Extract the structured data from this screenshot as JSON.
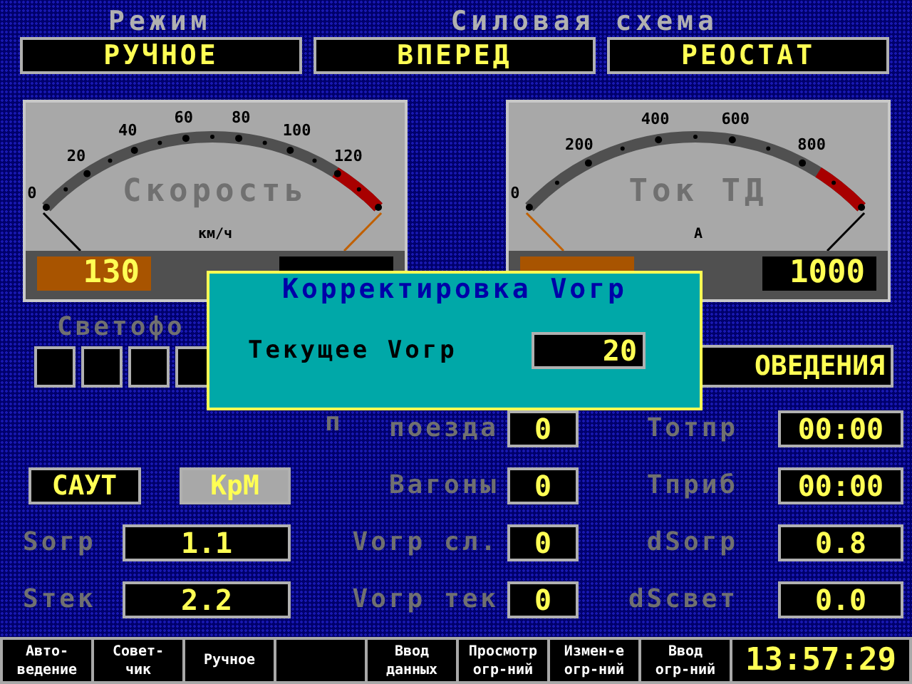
{
  "header_labels": [
    "Режим",
    "Силовая схема"
  ],
  "mode_fields": [
    "РУЧНОЕ",
    "ВПЕРЕД",
    "РЕОСТАТ"
  ],
  "gauges": [
    {
      "kind": "speed",
      "title": "Скорость",
      "unit": "км/ч",
      "scale": [
        "0",
        "20",
        "40",
        "60",
        "80",
        "100",
        "120"
      ],
      "readouts": [
        {
          "kind": "orange",
          "value": "130"
        },
        {
          "kind": "black"
        }
      ]
    },
    {
      "kind": "current",
      "title": "Ток ТД",
      "unit": "А",
      "scale": [
        "0",
        "200",
        "400",
        "600",
        "800"
      ],
      "readouts": [
        {
          "kind": "orange"
        },
        {
          "kind": "black",
          "value": "1000"
        }
      ]
    }
  ],
  "signal_label": "Светофо",
  "mode_button": "ОВЕДЕНИЯ",
  "train_buttons": [
    {
      "label": "САУТ",
      "selected": false
    },
    {
      "label": "КрМ",
      "selected": true
    }
  ],
  "left_params": [
    {
      "label": "Sогр",
      "value": "1.1"
    },
    {
      "label": "Sтек",
      "value": "2.2"
    }
  ],
  "mid_params": [
    {
      "prefix": "п",
      "label": "поезда",
      "value": "0"
    },
    {
      "label": "Вагоны",
      "value": "0"
    },
    {
      "label": "Vогр сл.",
      "value": "0"
    },
    {
      "label": "Vогр тек",
      "value": "0"
    }
  ],
  "right_params": [
    {
      "label": "Тотпр",
      "value": "00:00"
    },
    {
      "label": "Тприб",
      "value": "00:00"
    },
    {
      "label": "dSогр",
      "value": "0.8"
    },
    {
      "label": "dSсвет",
      "value": "0.0"
    }
  ],
  "dialog": {
    "title": "Корректировка Vогр",
    "field_label": "Текущее Vогр",
    "value": "20"
  },
  "function_keys": [
    {
      "kind": "key",
      "lines": [
        "Авто-",
        "ведение"
      ]
    },
    {
      "kind": "key",
      "lines": [
        "Совет-",
        "чик"
      ]
    },
    {
      "kind": "key",
      "lines": [
        "Ручное"
      ]
    },
    {
      "kind": "blank"
    },
    {
      "kind": "key",
      "lines": [
        "Ввод",
        "данных"
      ]
    },
    {
      "kind": "key",
      "lines": [
        "Просмотр",
        "огр-ний"
      ]
    },
    {
      "kind": "key",
      "lines": [
        "Измен-е",
        "огр-ний"
      ]
    },
    {
      "kind": "key",
      "lines": [
        "Ввод",
        "огр-ний"
      ]
    }
  ],
  "clock": "13:57:29"
}
